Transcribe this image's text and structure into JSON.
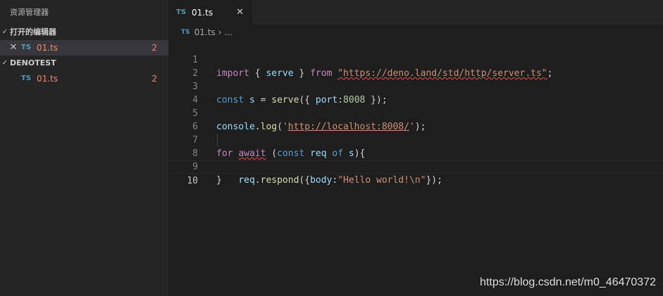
{
  "sidebar": {
    "title": "资源管理器",
    "open_editors_label": "打开的编辑器",
    "open_editors": [
      {
        "badge": "TS",
        "name": "01.ts",
        "count": "2"
      }
    ],
    "project_label": "DENOTEST",
    "files": [
      {
        "badge": "TS",
        "name": "01.ts",
        "count": "2"
      }
    ]
  },
  "tab": {
    "badge": "TS",
    "name": "01.ts",
    "close": "✕"
  },
  "breadcrumb": {
    "badge": "TS",
    "file": "01.ts",
    "more": "..."
  },
  "code": {
    "l1": {
      "n": "1",
      "import": "import",
      "ob": " { ",
      "serve": "serve",
      "cb": " } ",
      "from": "from",
      "sp": " ",
      "url": "\"https://deno.land/std/http/server.ts\"",
      "end": ";"
    },
    "l2": {
      "n": "2"
    },
    "l3": {
      "n": "3",
      "const": "const",
      "sp1": " ",
      "s": "s",
      "eq": " = ",
      "serve": "serve",
      "p1": "({ ",
      "port": "port",
      "colon": ":",
      "num": "8008",
      "p2": " });"
    },
    "l4": {
      "n": "4"
    },
    "l5": {
      "n": "5",
      "console": "console",
      "dot": ".",
      "log": "log",
      "p1": "(",
      "q1": "'",
      "url": "http://localhost:8008/",
      "q2": "'",
      "p2": ");"
    },
    "l6": {
      "n": "6"
    },
    "l7": {
      "n": "7",
      "for": "for",
      "sp1": " ",
      "await": "await",
      "sp2": " (",
      "const": "const",
      "sp3": " ",
      "req": "req",
      "sp4": " ",
      "of": "of",
      "sp5": " ",
      "s": "s",
      "end": "){"
    },
    "l8": {
      "n": "8",
      "indent": "    ",
      "req": "req",
      "dot": ".",
      "respond": "respond",
      "p1": "({",
      "body": "body",
      "colon": ":",
      "str": "\"Hello world!\\n\"",
      "p2": "});"
    },
    "l9": {
      "n": "9",
      "close": "}"
    },
    "l10": {
      "n": "10"
    }
  },
  "watermark": "https://blog.csdn.net/m0_46470372",
  "colors": {
    "keyword": "#c586c0",
    "storage": "#569cd6",
    "variable": "#9cdcfe",
    "function": "#dcdcaa",
    "string": "#ce9178",
    "number": "#b5cea8",
    "error": "#f48771"
  }
}
